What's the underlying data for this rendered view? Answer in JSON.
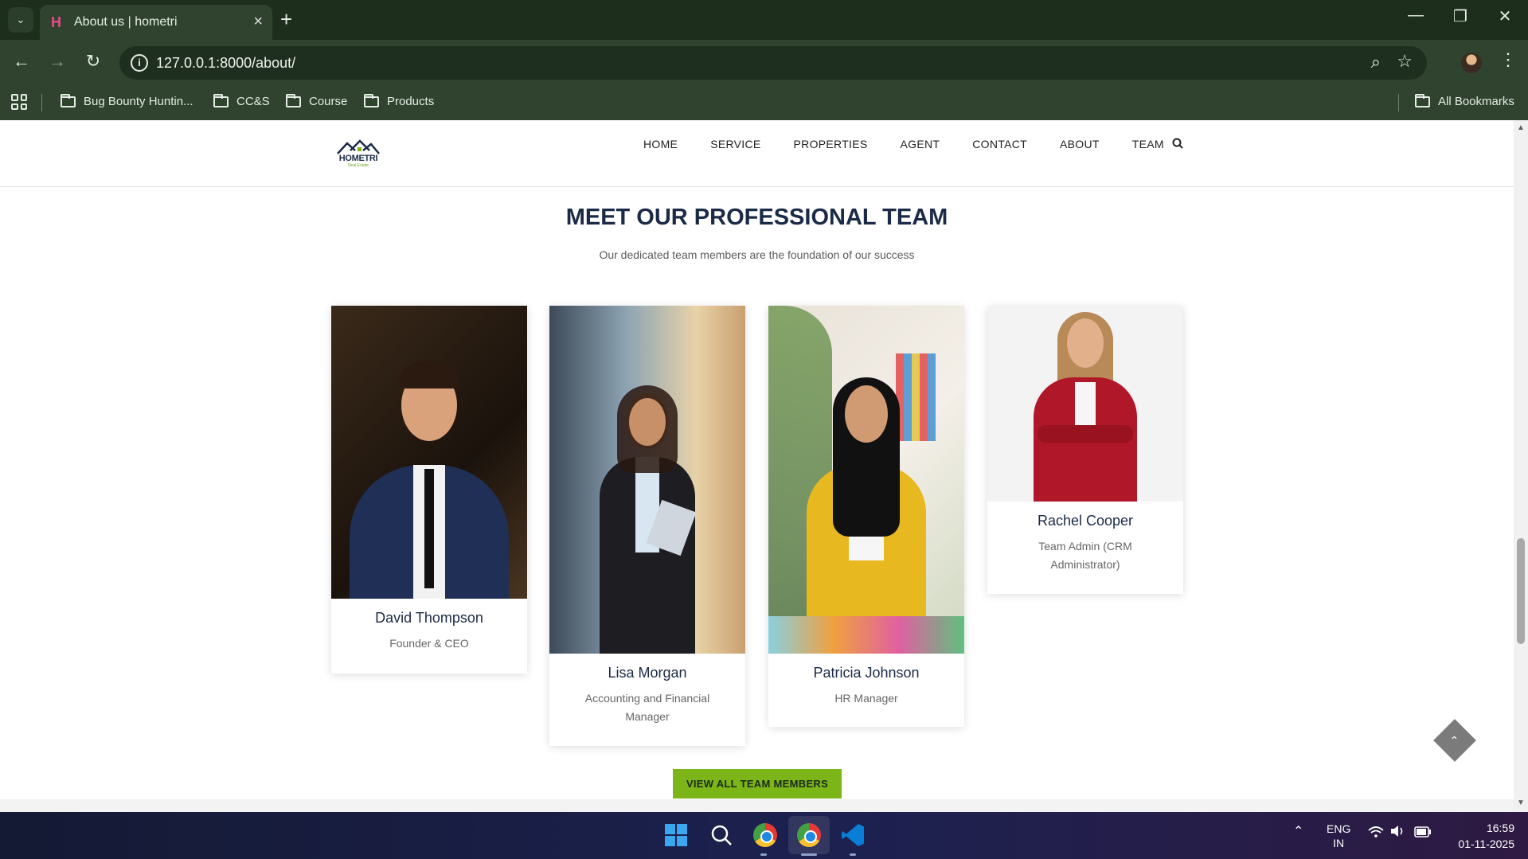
{
  "browser": {
    "tab_title": "About us | hometri",
    "tab_favicon": "H",
    "url": "127.0.0.1:8000/about/",
    "bookmarks": [
      "Bug Bounty Huntin...",
      "CC&S",
      "Course",
      "Products"
    ],
    "all_bookmarks": "All Bookmarks"
  },
  "site": {
    "logo": "HOMETRI",
    "logo_sub": "Real Estate",
    "nav": [
      "HOME",
      "SERVICE",
      "PROPERTIES",
      "AGENT",
      "CONTACT",
      "ABOUT",
      "TEAM"
    ]
  },
  "section": {
    "title": "MEET OUR PROFESSIONAL TEAM",
    "subtitle": "Our dedicated team members are the foundation of our success",
    "button": "VIEW ALL TEAM MEMBERS"
  },
  "team": [
    {
      "name": "David Thompson",
      "role": "Founder & CEO"
    },
    {
      "name": "Lisa Morgan",
      "role": "Accounting and Financial Manager"
    },
    {
      "name": "Patricia Johnson",
      "role": "HR Manager"
    },
    {
      "name": "Rachel Cooper",
      "role": "Team Admin (CRM Administrator)"
    }
  ],
  "taskbar": {
    "lang": "ENG",
    "region": "IN",
    "time": "16:59",
    "date": "01-11-2025"
  },
  "icons": [
    "chevron-down-icon",
    "close-icon",
    "plus-icon",
    "minimize-icon",
    "restore-icon",
    "back-icon",
    "forward-icon",
    "reload-icon",
    "info-icon",
    "zoom-icon",
    "star-icon",
    "kebab-icon",
    "apps-icon",
    "folder-icon",
    "search-icon",
    "chevron-up-icon",
    "windows-icon",
    "chrome-icon",
    "vscode-icon",
    "wifi-icon",
    "volume-icon",
    "battery-icon"
  ]
}
